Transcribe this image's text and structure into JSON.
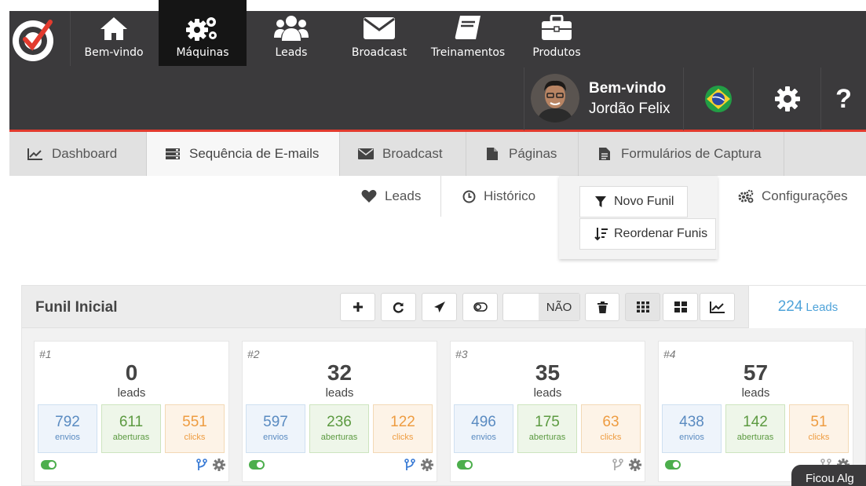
{
  "nav": {
    "items": [
      {
        "label": "Bem-vindo",
        "icon": "home-icon"
      },
      {
        "label": "Máquinas",
        "icon": "gears-icon"
      },
      {
        "label": "Leads",
        "icon": "users-icon"
      },
      {
        "label": "Broadcast",
        "icon": "envelope-icon"
      },
      {
        "label": "Treinamentos",
        "icon": "book-icon"
      },
      {
        "label": "Produtos",
        "icon": "briefcase-icon"
      }
    ],
    "active": "Máquinas"
  },
  "user": {
    "greeting": "Bem-vindo",
    "name": "Jordão Felix"
  },
  "tabs": [
    {
      "label": "Dashboard",
      "icon": "line-chart-icon"
    },
    {
      "label": "Sequência de E-mails",
      "icon": "server-icon"
    },
    {
      "label": "Broadcast",
      "icon": "envelope-icon"
    },
    {
      "label": "Páginas",
      "icon": "file-icon"
    },
    {
      "label": "Formulários de Captura",
      "icon": "file-text-icon"
    }
  ],
  "subtabs": {
    "leads": "Leads",
    "historico": "Histórico",
    "configuracoes": "Configurações"
  },
  "dropdown": {
    "novo_funil": "Novo Funil",
    "reordenar": "Reordenar Funis"
  },
  "funnel": {
    "title": "Funil Inicial",
    "toggle_label": "NÃO",
    "lead_count": "224",
    "lead_unit": "Leads",
    "cards": [
      {
        "idx": "#1",
        "leads": "0",
        "unit": "leads",
        "envios": "792",
        "aberturas": "611",
        "clicks": "551"
      },
      {
        "idx": "#2",
        "leads": "32",
        "unit": "leads",
        "envios": "597",
        "aberturas": "236",
        "clicks": "122"
      },
      {
        "idx": "#3",
        "leads": "35",
        "unit": "leads",
        "envios": "496",
        "aberturas": "175",
        "clicks": "63"
      },
      {
        "idx": "#4",
        "leads": "57",
        "unit": "leads",
        "envios": "438",
        "aberturas": "142",
        "clicks": "51"
      }
    ],
    "stat_labels": {
      "envios": "envios",
      "aberturas": "aberturas",
      "clicks": "clicks"
    }
  },
  "toast": "Ficou Alg",
  "colors": {
    "accent_red": "#e23b2e",
    "nav_bg": "#3b3a3c",
    "link_blue": "#4fa3d9"
  }
}
